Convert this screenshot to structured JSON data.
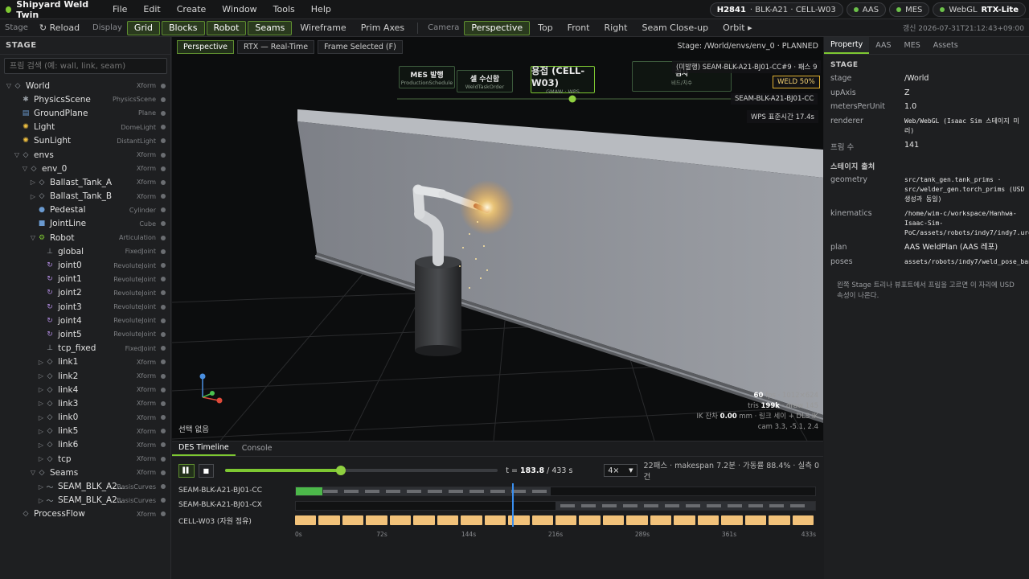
{
  "app": {
    "title": "Shipyard Weld Twin",
    "menu": [
      "File",
      "Edit",
      "Create",
      "Window",
      "Tools",
      "Help"
    ],
    "status_pills": [
      {
        "bold": "H2841",
        "text": "· BLK-A21 · CELL-W03",
        "dot": false
      },
      {
        "bold": "",
        "text": "AAS",
        "dot": true
      },
      {
        "bold": "",
        "text": "MES",
        "dot": true
      },
      {
        "bold": "RTX-Lite",
        "text": "WebGL",
        "dot": true
      }
    ]
  },
  "toolbar": {
    "stage_label": "Stage",
    "reload": "↻ Reload",
    "display_label": "Display",
    "display_buttons": [
      {
        "label": "Grid",
        "on": true
      },
      {
        "label": "Blocks",
        "on": true
      },
      {
        "label": "Robot",
        "on": true
      },
      {
        "label": "Seams",
        "on": true
      },
      {
        "label": "Wireframe",
        "on": false
      },
      {
        "label": "Prim Axes",
        "on": false
      }
    ],
    "camera_label": "Camera",
    "camera_buttons": [
      {
        "label": "Perspective",
        "on": true
      },
      {
        "label": "Top",
        "on": false
      },
      {
        "label": "Front",
        "on": false
      },
      {
        "label": "Right",
        "on": false
      },
      {
        "label": "Seam Close-up",
        "on": false
      },
      {
        "label": "Orbit ▸",
        "on": false
      }
    ],
    "updated": "갱신 2026-07-31T21:12:43+09:00"
  },
  "stage": {
    "title": "STAGE",
    "search_placeholder": "프림 검색 (예: wall, link, seam)",
    "tree": [
      {
        "depth": 0,
        "arrow": "▽",
        "icon": "◇",
        "name": "World",
        "type": "Xform"
      },
      {
        "depth": 1,
        "arrow": "",
        "icon": "✱",
        "name": "PhysicsScene",
        "type": "PhysicsScene"
      },
      {
        "depth": 1,
        "arrow": "",
        "icon": "▤",
        "name": "GroundPlane",
        "type": "Plane"
      },
      {
        "depth": 1,
        "arrow": "",
        "icon": "✺",
        "name": "Light",
        "type": "DomeLight"
      },
      {
        "depth": 1,
        "arrow": "",
        "icon": "✺",
        "name": "SunLight",
        "type": "DistantLight"
      },
      {
        "depth": 1,
        "arrow": "▽",
        "icon": "◇",
        "name": "envs",
        "type": "Xform"
      },
      {
        "depth": 2,
        "arrow": "▽",
        "icon": "◇",
        "name": "env_0",
        "type": "Xform"
      },
      {
        "depth": 3,
        "arrow": "▷",
        "icon": "◇",
        "name": "Ballast_Tank_A",
        "type": "Xform"
      },
      {
        "depth": 3,
        "arrow": "▷",
        "icon": "◇",
        "name": "Ballast_Tank_B",
        "type": "Xform"
      },
      {
        "depth": 3,
        "arrow": "",
        "icon": "●",
        "name": "Pedestal",
        "type": "Cylinder"
      },
      {
        "depth": 3,
        "arrow": "",
        "icon": "■",
        "name": "JointLine",
        "type": "Cube"
      },
      {
        "depth": 3,
        "arrow": "▽",
        "icon": "⚙",
        "name": "Robot",
        "type": "Articulation"
      },
      {
        "depth": 4,
        "arrow": "",
        "icon": "⊥",
        "name": "global",
        "type": "FixedJoint"
      },
      {
        "depth": 4,
        "arrow": "",
        "icon": "↻",
        "name": "joint0",
        "type": "RevoluteJoint"
      },
      {
        "depth": 4,
        "arrow": "",
        "icon": "↻",
        "name": "joint1",
        "type": "RevoluteJoint"
      },
      {
        "depth": 4,
        "arrow": "",
        "icon": "↻",
        "name": "joint2",
        "type": "RevoluteJoint"
      },
      {
        "depth": 4,
        "arrow": "",
        "icon": "↻",
        "name": "joint3",
        "type": "RevoluteJoint"
      },
      {
        "depth": 4,
        "arrow": "",
        "icon": "↻",
        "name": "joint4",
        "type": "RevoluteJoint"
      },
      {
        "depth": 4,
        "arrow": "",
        "icon": "↻",
        "name": "joint5",
        "type": "RevoluteJoint"
      },
      {
        "depth": 4,
        "arrow": "",
        "icon": "⊥",
        "name": "tcp_fixed",
        "type": "FixedJoint"
      },
      {
        "depth": 4,
        "arrow": "▷",
        "icon": "◇",
        "name": "link1",
        "type": "Xform"
      },
      {
        "depth": 4,
        "arrow": "▷",
        "icon": "◇",
        "name": "link2",
        "type": "Xform"
      },
      {
        "depth": 4,
        "arrow": "▷",
        "icon": "◇",
        "name": "link4",
        "type": "Xform"
      },
      {
        "depth": 4,
        "arrow": "▷",
        "icon": "◇",
        "name": "link3",
        "type": "Xform"
      },
      {
        "depth": 4,
        "arrow": "▷",
        "icon": "◇",
        "name": "link0",
        "type": "Xform"
      },
      {
        "depth": 4,
        "arrow": "▷",
        "icon": "◇",
        "name": "link5",
        "type": "Xform"
      },
      {
        "depth": 4,
        "arrow": "▷",
        "icon": "◇",
        "name": "link6",
        "type": "Xform"
      },
      {
        "depth": 4,
        "arrow": "▷",
        "icon": "◇",
        "name": "tcp",
        "type": "Xform"
      },
      {
        "depth": 3,
        "arrow": "▽",
        "icon": "◇",
        "name": "Seams",
        "type": "Xform"
      },
      {
        "depth": 4,
        "arrow": "▷",
        "icon": "〜",
        "name": "SEAM_BLK_A2...",
        "type": "BasisCurves"
      },
      {
        "depth": 4,
        "arrow": "▷",
        "icon": "〜",
        "name": "SEAM_BLK_A2...",
        "type": "BasisCurves"
      },
      {
        "depth": 1,
        "arrow": "",
        "icon": "◇",
        "name": "ProcessFlow",
        "type": "Xform"
      }
    ]
  },
  "viewport": {
    "tabs": [
      {
        "label": "Perspective",
        "on": true
      },
      {
        "label": "RTX — Real-Time",
        "on": false
      },
      {
        "label": "Frame Selected (F)",
        "on": false
      }
    ],
    "path": "Stage: /World/envs/env_0 · PLANNED",
    "schedule": [
      {
        "title": "MES 발행",
        "sub": "ProductionSchedule"
      },
      {
        "title": "셀 수신함",
        "sub": "WeldTaskOrder"
      },
      {
        "title": "용접 (CELL-W03)",
        "sub": "GMAW · WPS"
      },
      {
        "title": "검사",
        "sub": "비드/치수"
      }
    ],
    "tags": {
      "unpublished": "(미발행) SEAM-BLK-A21-BJ01-CC#9 · 패스 9",
      "weld": "WELD 50%",
      "seam": "SEAM-BLK-A21-BJ01-CC",
      "wps": "WPS 표준시간 17.4s"
    },
    "stats": {
      "fps": "60",
      "fps_rest": "fps · 1012×624",
      "tris": "199k",
      "tris_prefix": "tris",
      "tris_rest": "· draw 145",
      "ik_prefix": "IK 잔차",
      "ik": "0.00",
      "ik_rest": "mm · 링크 세이 + DLS IK",
      "cam": "cam 3.3, -5.1, 2.4"
    },
    "selection": "선택 없음"
  },
  "timeline": {
    "tabs": [
      {
        "label": "DES Timeline",
        "on": true
      },
      {
        "label": "Console",
        "on": false
      }
    ],
    "pause_icon": "▌▌",
    "stop_icon": "■",
    "progress": 0.425,
    "t_prefix": "t =",
    "t_value": "183.8",
    "t_total": "/ 433 s",
    "speed": "4×",
    "summary": "22패스 · makespan 7.2분 · 가동률 88.4% · 실측 0건",
    "lanes": [
      {
        "label": "SEAM-BLK-A21-BJ01-CC"
      },
      {
        "label": "SEAM-BLK-A21-BJ01-CX"
      },
      {
        "label": "CELL-W03 (자원 점유)"
      }
    ],
    "ticks": [
      "0s",
      "72s",
      "144s",
      "216s",
      "289s",
      "361s",
      "433s"
    ],
    "total_seconds": 433,
    "cc_active_end": 0.045,
    "cc_planned_end": 0.49,
    "cx_planned_start": 0.5,
    "resource_blocks": 22
  },
  "properties": {
    "tabs": [
      {
        "label": "Property",
        "on": true
      },
      {
        "label": "AAS",
        "on": false
      },
      {
        "label": "MES",
        "on": false
      },
      {
        "label": "Assets",
        "on": false
      }
    ],
    "stage_section": "STAGE",
    "stage_rows": [
      {
        "k": "stage",
        "v": "/World",
        "mono": false
      },
      {
        "k": "upAxis",
        "v": "Z",
        "mono": false
      },
      {
        "k": "metersPerUnit",
        "v": "1.0",
        "mono": false
      },
      {
        "k": "renderer",
        "v": "Web/WebGL (Isaac Sim 스테이지 미러)",
        "mono": true
      },
      {
        "k": "프림 수",
        "v": "141",
        "mono": false
      }
    ],
    "source_section": "스테이지 출처",
    "source_rows": [
      {
        "k": "geometry",
        "v": "src/tank_gen.tank_prims · src/welder_gen.torch_prims (USD 생성과 동일)",
        "mono": true
      },
      {
        "k": "kinematics",
        "v": "/home/wim-c/workspace/Hanhwa-Isaac-Sim-PoC/assets/robots/indy7/indy7.urdf",
        "mono": true
      },
      {
        "k": "plan",
        "v": "AAS WeldPlan (AAS 레포)",
        "mono": false
      },
      {
        "k": "poses",
        "v": "assets/robots/indy7/weld_pose_bank.npz",
        "mono": true
      }
    ],
    "note": "왼쪽 Stage 트리나 뷰포트에서 프림을 고르면 이 자리에 USD 속성이 나온다."
  },
  "colors": {
    "accent": "#7ec832",
    "resource": "#f2c27a",
    "playhead": "#3a8ff0"
  }
}
